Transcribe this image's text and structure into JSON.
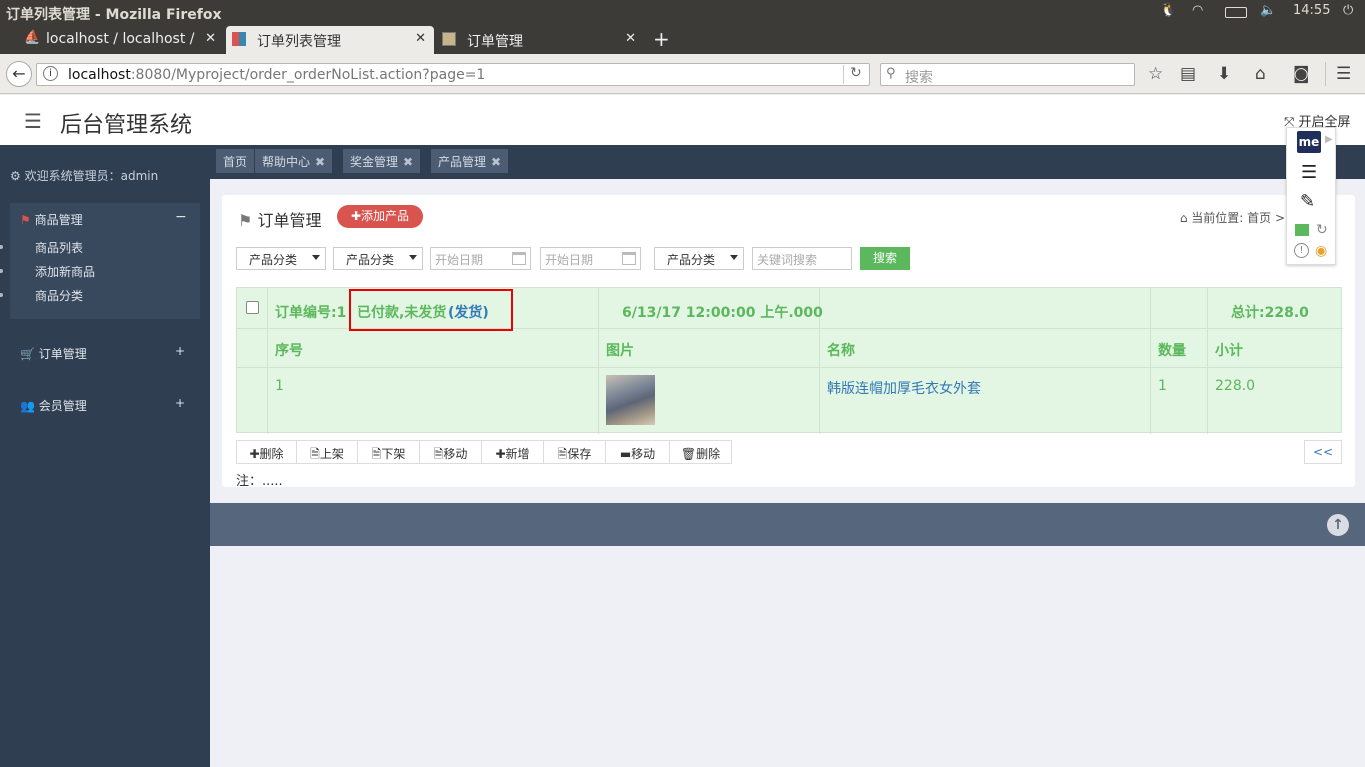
{
  "os": {
    "window_title": "订单列表管理 - Mozilla Firefox",
    "time": "14:55"
  },
  "browser": {
    "tabs": [
      {
        "label": "localhost / localhost /"
      },
      {
        "label": "订单列表管理"
      },
      {
        "label": "订单管理"
      }
    ],
    "new_tab": "+",
    "url_host": "localhost",
    "url_rest": ":8080/Myproject/order_orderNoList.action?page=1",
    "search_placeholder": "搜索"
  },
  "header": {
    "title": "后台管理系统",
    "fullscreen": "开启全屏"
  },
  "sidebar": {
    "welcome": "欢迎系统管理员：admin",
    "groups": [
      {
        "label": "商品管理",
        "toggle": "−",
        "items": [
          {
            "label": "商品列表"
          },
          {
            "label": "添加新商品"
          },
          {
            "label": "商品分类"
          }
        ]
      },
      {
        "label": "订单管理",
        "toggle": "+"
      },
      {
        "label": "会员管理",
        "toggle": "+"
      }
    ]
  },
  "content_tabs": [
    {
      "label": "首页"
    },
    {
      "label": "帮助中心"
    },
    {
      "label": "奖金管理"
    },
    {
      "label": "产品管理"
    }
  ],
  "panel": {
    "title": "订单管理",
    "add_button": "添加产品",
    "breadcrumb": "当前位置:  首页 >"
  },
  "filters": {
    "select1": "产品分类",
    "select2": "产品分类",
    "date1": "开始日期",
    "date2": "开始日期",
    "select3": "产品分类",
    "keyword_placeholder": "关键词搜索",
    "search_button": "搜索"
  },
  "order": {
    "order_no": "订单编号:1",
    "status": "已付款,未发货",
    "ship_link": "(发货)",
    "datetime": "6/13/17 12:00:00 上午.000",
    "total": "总计:228.0",
    "columns": [
      "序号",
      "图片",
      "名称",
      "数量",
      "小计"
    ],
    "rows": [
      {
        "index": "1",
        "name": "韩版连帽加厚毛衣女外套",
        "qty": "1",
        "subtotal": "228.0"
      }
    ]
  },
  "actions": [
    {
      "label": "删除"
    },
    {
      "label": "上架"
    },
    {
      "label": "下架"
    },
    {
      "label": "移动"
    },
    {
      "label": "新增"
    },
    {
      "label": "保存"
    },
    {
      "label": "移动"
    },
    {
      "label": "删除"
    }
  ],
  "pager_prev": "<<",
  "note": "注：.....",
  "colors": {
    "sidebar": "#2f3e51",
    "accent_green": "#5cb85c",
    "danger": "#d9534f",
    "link": "#337ab7"
  }
}
